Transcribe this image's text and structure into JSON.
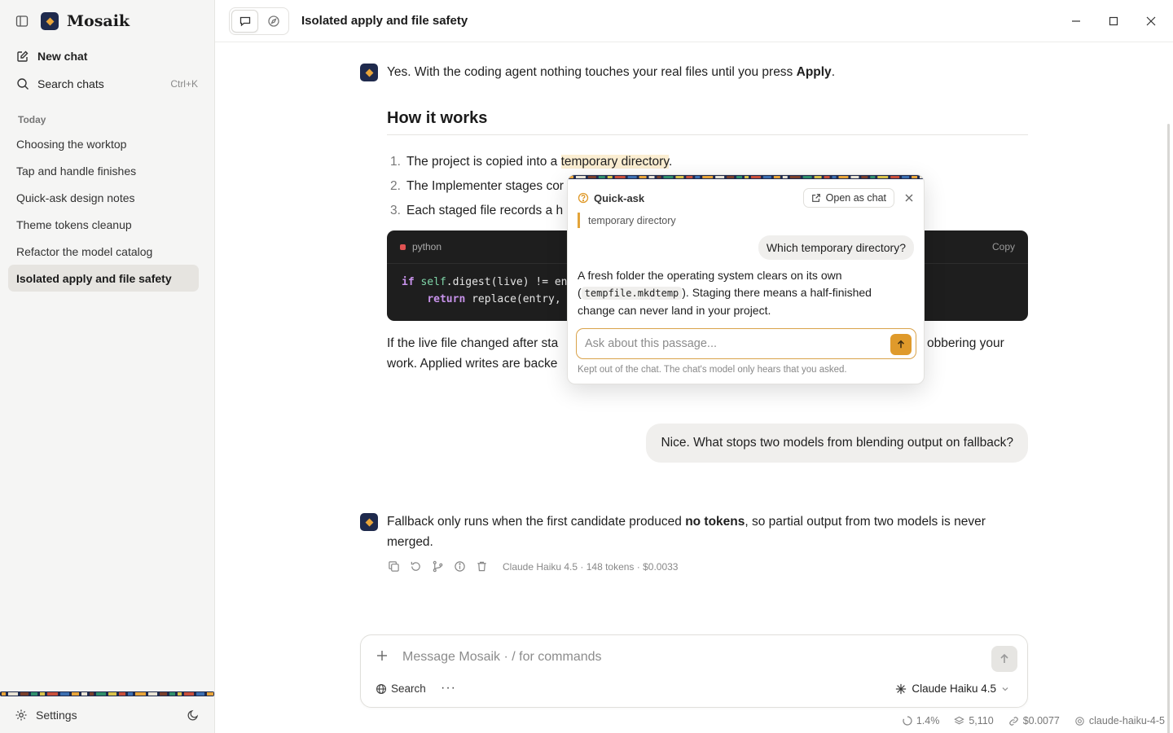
{
  "app": {
    "brand": "Mosaik",
    "chat_title": "Isolated apply and file safety"
  },
  "sidebar": {
    "new_chat": "New chat",
    "search_chats": "Search chats",
    "search_shortcut": "Ctrl+K",
    "section_today": "Today",
    "items": [
      {
        "label": "Choosing the worktop"
      },
      {
        "label": "Tap and handle finishes"
      },
      {
        "label": "Quick-ask design notes"
      },
      {
        "label": "Theme tokens cleanup"
      },
      {
        "label": "Refactor the model catalog"
      },
      {
        "label": "Isolated apply and file safety"
      }
    ],
    "settings": "Settings"
  },
  "conversation": {
    "msg1_pre": "Yes. With the coding agent nothing touches your real files until you press ",
    "msg1_bold": "Apply",
    "msg1_post": ".",
    "heading": "How it works",
    "steps": [
      {
        "num": "1.",
        "pre": "The project is copied into a ",
        "hl": "temporary directory",
        "post": "."
      },
      {
        "num": "2.",
        "text": "The Implementer stages cor"
      },
      {
        "num": "3.",
        "text": "Each staged file records a h"
      }
    ],
    "code": {
      "lang": "python",
      "copy_label": "Copy",
      "line1_kw": "if",
      "line1_self": "self",
      "line1_rest": ".digest(live) != en",
      "line2_kw": "return",
      "line2_rest": " replace(entry,"
    },
    "para_line1_left": "If the live file changed after sta",
    "para_line1_right": "obbering your",
    "para_line2": "work. Applied writes are backe",
    "user_msg": "Nice. What stops two models from blending output on fallback?",
    "msg2_pre": "Fallback only runs when the first candidate produced ",
    "msg2_bold": "no tokens",
    "msg2_post": ", so partial output from two models is never merged.",
    "meta": "Claude Haiku 4.5 · 148 tokens · $0.0033"
  },
  "quick_ask": {
    "title": "Quick-ask",
    "open_as_chat": "Open as chat",
    "quote": "temporary directory",
    "question": "Which temporary directory?",
    "answer_pre": "A fresh folder the operating system clears on its own (",
    "answer_code": "tempfile.mkdtemp",
    "answer_post": "). Staging there means a half-finished change can never land in your project.",
    "placeholder": "Ask about this passage...",
    "footnote": "Kept out of the chat. The chat's model only hears that you asked."
  },
  "composer": {
    "placeholder": "Message Mosaik  ·  / for commands",
    "search_label": "Search",
    "model_label": "Claude Haiku 4.5"
  },
  "status": {
    "context": "1.4%",
    "tokens": "5,110",
    "cost": "$0.0077",
    "model_id": "claude-haiku-4-5"
  },
  "colors": {
    "accent": "#df9a2b",
    "brand_navy": "#1f2a4d",
    "highlight": "#fbeed2"
  }
}
